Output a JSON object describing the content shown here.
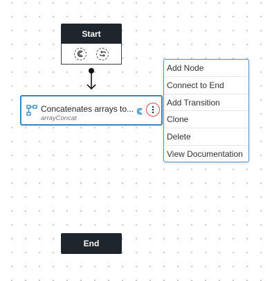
{
  "start_node": {
    "label": "Start",
    "icons": [
      "concatenate-icon",
      "loop-icon"
    ]
  },
  "action_node": {
    "title": "Concatenates arrays to...",
    "subtitle": "arrayConcat",
    "type_icon": "workflow-icon",
    "status_icon": "concatenate-icon",
    "menu_icon": "more-vertical-icon"
  },
  "context_menu": {
    "items": [
      {
        "label": "Add Node"
      },
      {
        "label": "Connect to End"
      },
      {
        "label": "Add Transition"
      },
      {
        "label": "Clone"
      },
      {
        "label": "Delete"
      },
      {
        "label": "View Documentation"
      }
    ]
  },
  "end_node": {
    "label": "End"
  },
  "colors": {
    "node_dark": "#1e252d",
    "selected_border": "#2e86c9",
    "menu_border": "#4a90d9",
    "menu_button_ring": "#e04848"
  }
}
